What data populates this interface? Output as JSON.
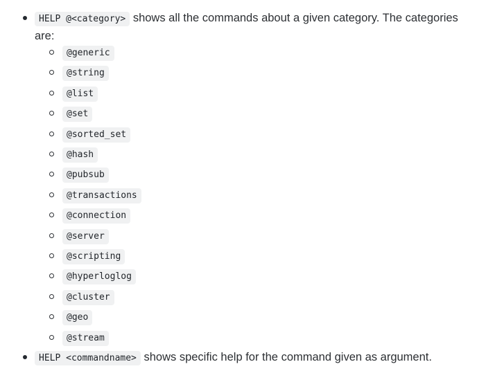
{
  "item1": {
    "code": "HELP @<category>",
    "text_line1": " shows all the commands about a given category. The categories",
    "text_line2": "are:"
  },
  "categories": [
    "@generic",
    "@string",
    "@list",
    "@set",
    "@sorted_set",
    "@hash",
    "@pubsub",
    "@transactions",
    "@connection",
    "@server",
    "@scripting",
    "@hyperloglog",
    "@cluster",
    "@geo",
    "@stream"
  ],
  "item2": {
    "code": "HELP <commandname>",
    "text": " shows specific help for the command given as argument."
  }
}
